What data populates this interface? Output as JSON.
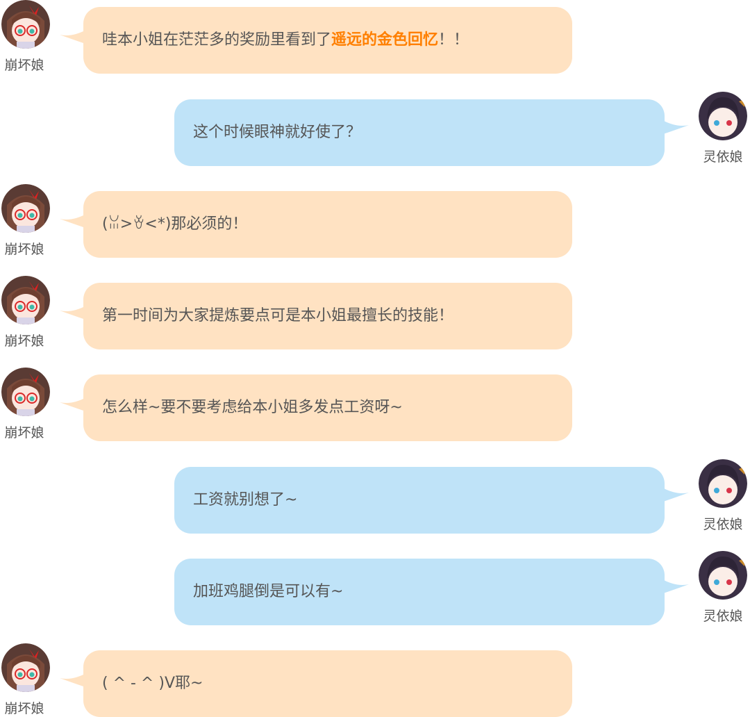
{
  "colors": {
    "left_bubble": "#ffe2c2",
    "right_bubble": "#bfe3f8",
    "highlight": "#ff7f00",
    "text": "#555555"
  },
  "messages": [
    {
      "side": "left",
      "name": "崩坏娘",
      "avatar": "glasses-girl-avatar",
      "text": "哇本小姐在茫茫多的奖励里看到了",
      "highlight": "遥远的金色回忆",
      "text_after": "！！"
    },
    {
      "side": "right",
      "name": "灵依娘",
      "avatar": "dark-hair-girl-avatar",
      "text": "这个时候眼神就好使了？"
    },
    {
      "side": "left",
      "name": "崩坏娘",
      "avatar": "glasses-girl-avatar",
      "text": "(ꈍ>ꈊ<*)那必须的！"
    },
    {
      "side": "left",
      "name": "崩坏娘",
      "avatar": "glasses-girl-avatar",
      "text": "第一时间为大家提炼要点可是本小姐最擅长的技能！"
    },
    {
      "side": "left",
      "name": "崩坏娘",
      "avatar": "glasses-girl-avatar",
      "text": "怎么样~要不要考虑给本小姐多发点工资呀~"
    },
    {
      "side": "right",
      "name": "灵依娘",
      "avatar": "dark-hair-girl-avatar",
      "text": "工资就别想了~"
    },
    {
      "side": "right",
      "name": "灵依娘",
      "avatar": "dark-hair-girl-avatar",
      "text": "加班鸡腿倒是可以有~"
    },
    {
      "side": "left",
      "name": "崩坏娘",
      "avatar": "glasses-girl-avatar",
      "text": "( ^ - ^ )V耶~"
    }
  ]
}
